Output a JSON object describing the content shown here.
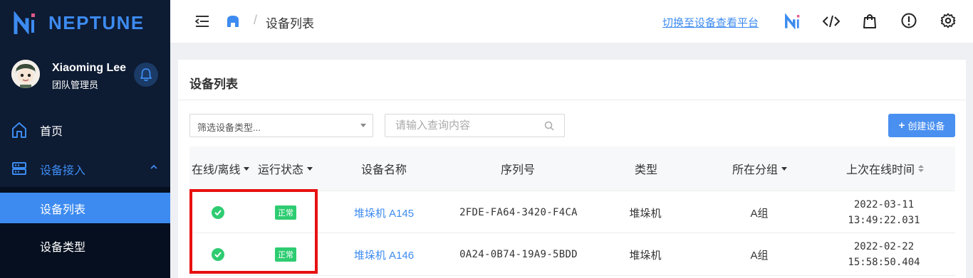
{
  "app": {
    "name": "NEPTUNE"
  },
  "user": {
    "name": "Xiaoming Lee",
    "role": "团队管理员"
  },
  "sidebar": {
    "items": [
      {
        "label": "首页"
      },
      {
        "label": "设备接入"
      }
    ],
    "subitems": [
      {
        "label": "设备列表"
      },
      {
        "label": "设备类型"
      }
    ]
  },
  "header": {
    "breadcrumb": "设备列表",
    "switch_link": "切换至设备查看平台"
  },
  "card": {
    "title": "设备列表"
  },
  "filters": {
    "type_select": "筛选设备类型...",
    "search_placeholder": "请输入查询内容",
    "create_button": "创建设备",
    "create_button_icon": "plus-icon"
  },
  "table": {
    "columns": {
      "online": "在线/离线",
      "status": "运行状态",
      "name": "设备名称",
      "serial": "序列号",
      "type": "类型",
      "group": "所在分组",
      "last_online": "上次在线时间"
    },
    "rows": [
      {
        "online_icon": "check-circle-icon",
        "status": "正常",
        "name": "堆垛机 A145",
        "serial": "2FDE-FA64-3420-F4CA",
        "type": "堆垛机",
        "group": "A组",
        "date": "2022-03-11",
        "time": "13:49:22.031"
      },
      {
        "online_icon": "check-circle-icon",
        "status": "正常",
        "name": "堆垛机 A146",
        "serial": "0A24-0B74-19A9-5BDD",
        "type": "堆垛机",
        "group": "A组",
        "date": "2022-02-22",
        "time": "15:58:50.404"
      }
    ]
  },
  "colors": {
    "sidebar_bg": "#0d1b33",
    "accent": "#3d8bf0",
    "success": "#2ecc71",
    "highlight": "#e81010"
  }
}
